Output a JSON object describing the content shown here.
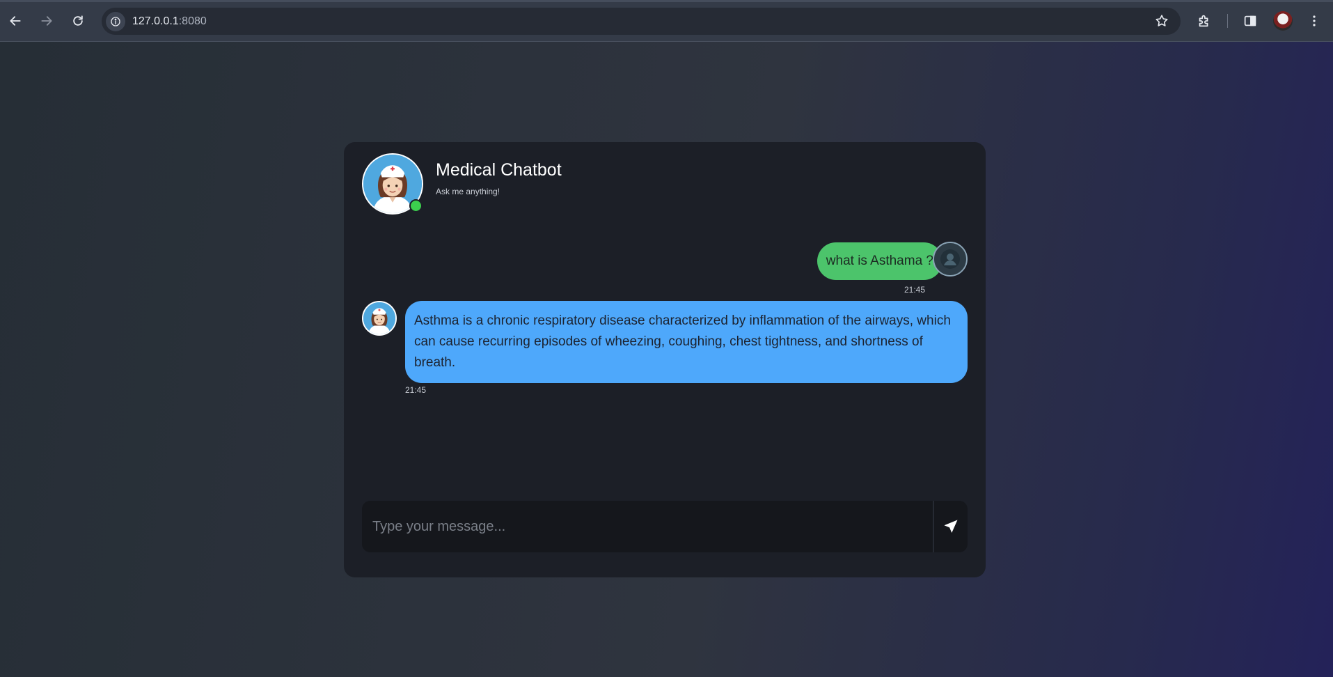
{
  "browser": {
    "url_host": "127.0.0.1",
    "url_port": ":8080",
    "icons": [
      "back-arrow-icon",
      "forward-arrow-icon",
      "reload-icon",
      "site-info-icon",
      "bookmark-star-icon",
      "extensions-icon",
      "side-panel-icon",
      "profile-avatar",
      "more-menu-icon"
    ]
  },
  "chat": {
    "title": "Medical Chatbot",
    "subtitle": "Ask me anything!",
    "messages": [
      {
        "sender": "user",
        "text": "what is Asthama ?",
        "time": "21:45"
      },
      {
        "sender": "bot",
        "text": "Asthma is a chronic respiratory disease characterized by inflammation of the airways, which can cause recurring episodes of wheezing, coughing, chest tightness, and shortness of breath.",
        "time": "21:45"
      }
    ],
    "input": {
      "placeholder": "Type your message...",
      "value": ""
    }
  },
  "colors": {
    "user_bubble": "#4cc46b",
    "bot_bubble": "#4ea8fb",
    "card_bg": "#1c1f27",
    "online_dot": "#3ccf4e"
  }
}
